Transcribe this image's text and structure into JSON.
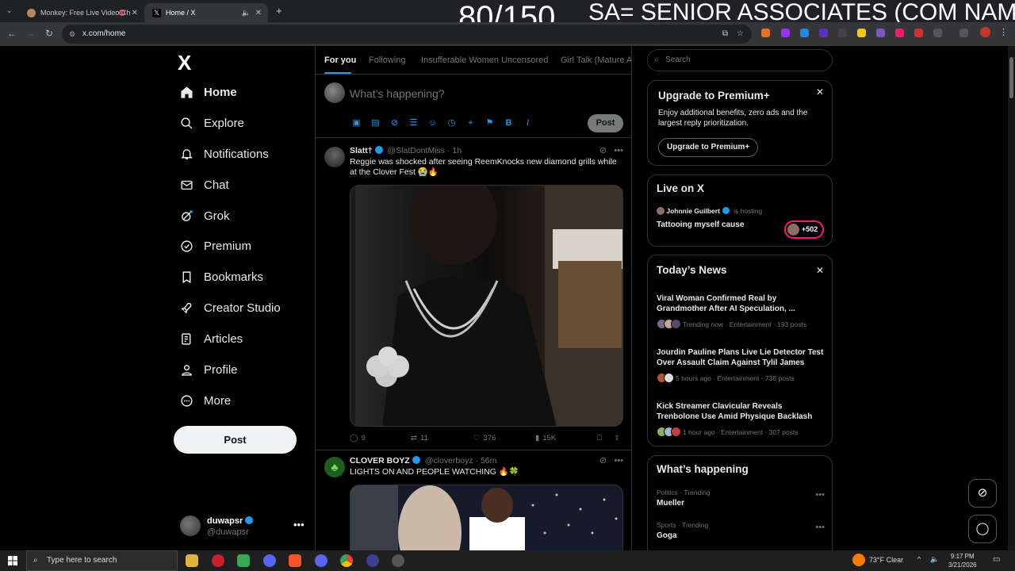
{
  "overlay": {
    "count": "80/150",
    "caption": "SA= SENIOR ASSOCIATES (COM NAME)"
  },
  "browser": {
    "tabs": [
      {
        "title": "Monkey: Free Live Video Ch",
        "active": false
      },
      {
        "title": "Home / X",
        "active": true
      }
    ],
    "url": "x.com/home"
  },
  "sidebar": {
    "logo": "X",
    "items": [
      {
        "label": "Home",
        "icon": "home-icon"
      },
      {
        "label": "Explore",
        "icon": "search-icon"
      },
      {
        "label": "Notifications",
        "icon": "bell-icon"
      },
      {
        "label": "Chat",
        "icon": "mail-icon"
      },
      {
        "label": "Grok",
        "icon": "grok-icon"
      },
      {
        "label": "Premium",
        "icon": "verified-icon"
      },
      {
        "label": "Bookmarks",
        "icon": "bookmark-icon"
      },
      {
        "label": "Creator Studio",
        "icon": "rocket-icon"
      },
      {
        "label": "Articles",
        "icon": "article-icon"
      },
      {
        "label": "Profile",
        "icon": "person-icon"
      },
      {
        "label": "More",
        "icon": "more-circle-icon"
      }
    ],
    "post_label": "Post",
    "account": {
      "name": "duwapsr",
      "handle": "@duwapsr"
    }
  },
  "feed": {
    "tabs": [
      "For you",
      "Following",
      "Insufferable Women Uncensored",
      "Girl Talk (Mature Ad"
    ],
    "composer_placeholder": "What’s happening?",
    "composer_post": "Post",
    "tweets": [
      {
        "name": "Slatt†",
        "handle": "@SlatDontMiss",
        "time": "· 1h",
        "text": "Reggie was shocked after seeing ReemKnocks new diamond grills while at the Clover Fest 😭🔥",
        "replies": "9",
        "reposts": "11",
        "likes": "376",
        "views": "15K"
      },
      {
        "name": "CLOVER BOYZ",
        "handle": "@cloverboyz",
        "time": "· 56m",
        "text": "LIGHTS ON AND PEOPLE WATCHING 🔥🍀"
      }
    ]
  },
  "right": {
    "search_placeholder": "Search",
    "premium": {
      "title": "Upgrade to Premium+",
      "desc": "Enjoy additional benefits, zero ads and the largest reply prioritization.",
      "button": "Upgrade to Premium+"
    },
    "live": {
      "title": "Live on X",
      "host": "Johnnie Guilbert",
      "hosting": "is hosting",
      "topic": "Tattooing myself cause",
      "count": "+502"
    },
    "news": {
      "title": "Today’s News",
      "items": [
        {
          "title": "Viral Woman Confirmed Real by Grandmother After AI Speculation, ...",
          "meta": "Trending now · Entertainment · 193 posts"
        },
        {
          "title": "Jourdin Pauline Plans Live Lie Detector Test Over Assault Claim Against Tylil James",
          "meta": "5 hours ago · Entertainment · 736 posts"
        },
        {
          "title": "Kick Streamer Clavicular Reveals Trenbolone Use Amid Physique Backlash",
          "meta": "1 hour ago · Entertainment · 307 posts"
        }
      ]
    },
    "happening": {
      "title": "What’s happening",
      "trends": [
        {
          "category": "Politics · Trending",
          "name": "Mueller"
        },
        {
          "category": "Sports · Trending",
          "name": "Goga"
        }
      ]
    }
  },
  "taskbar": {
    "search_placeholder": "Type here to search",
    "weather": "73°F  Clear",
    "time": "9:17 PM",
    "date": "3/21/2026"
  },
  "colors": {
    "accent": "#1d9bf0",
    "background": "#000000",
    "border": "#2f3336",
    "muted": "#71767b"
  }
}
